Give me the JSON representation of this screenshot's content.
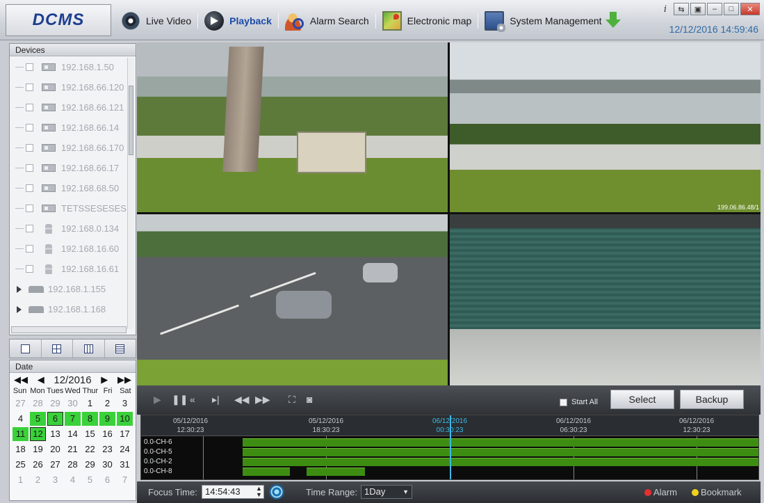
{
  "app": {
    "logo": "DCMS",
    "datetime": "12/12/2016 14:59:46"
  },
  "nav": {
    "items": [
      {
        "label": "Live Video",
        "icon": "camera-eye-icon"
      },
      {
        "label": "Playback",
        "icon": "playback-icon",
        "active": true
      },
      {
        "label": "Alarm Search",
        "icon": "alarm-search-icon"
      },
      {
        "label": "Electronic map",
        "icon": "map-icon"
      },
      {
        "label": "System Management",
        "icon": "system-management-icon"
      }
    ]
  },
  "devices": {
    "title": "Devices",
    "items": [
      {
        "label": "192.168.1.50",
        "type": "camera"
      },
      {
        "label": "192.168.66.120",
        "type": "camera"
      },
      {
        "label": "192.168.66.121",
        "type": "camera"
      },
      {
        "label": "192.168.66.14",
        "type": "camera"
      },
      {
        "label": "192.168.66.170",
        "type": "camera"
      },
      {
        "label": "192.168.66.17",
        "type": "camera"
      },
      {
        "label": "192.168.68.50",
        "type": "camera"
      },
      {
        "label": "TETSSESESES",
        "type": "camera"
      },
      {
        "label": "192.168.0.134",
        "type": "dome"
      },
      {
        "label": "192.168.16.60",
        "type": "dome"
      },
      {
        "label": "192.168.16.61",
        "type": "dome"
      },
      {
        "label": "192.168.1.155",
        "type": "nvr"
      },
      {
        "label": "192.168.1.168",
        "type": "nvr"
      }
    ]
  },
  "date": {
    "title": "Date",
    "month_label": "12/2016",
    "weekdays": [
      "Sun",
      "Mon",
      "Tues",
      "Wed",
      "Thur",
      "Fri",
      "Sat"
    ],
    "days": [
      {
        "d": "27",
        "m": 1
      },
      {
        "d": "28",
        "m": 1
      },
      {
        "d": "29",
        "m": 1
      },
      {
        "d": "30",
        "m": 1
      },
      {
        "d": "1"
      },
      {
        "d": "2"
      },
      {
        "d": "3"
      },
      {
        "d": "4"
      },
      {
        "d": "5",
        "r": 1
      },
      {
        "d": "6",
        "r": 1,
        "s": 1
      },
      {
        "d": "7",
        "r": 1
      },
      {
        "d": "8",
        "r": 1
      },
      {
        "d": "9",
        "r": 1
      },
      {
        "d": "10",
        "r": 1
      },
      {
        "d": "11",
        "r": 1
      },
      {
        "d": "12",
        "r": 1,
        "s": 1
      },
      {
        "d": "13"
      },
      {
        "d": "14"
      },
      {
        "d": "15"
      },
      {
        "d": "16"
      },
      {
        "d": "17"
      },
      {
        "d": "18"
      },
      {
        "d": "19"
      },
      {
        "d": "20"
      },
      {
        "d": "21"
      },
      {
        "d": "22"
      },
      {
        "d": "23"
      },
      {
        "d": "24"
      },
      {
        "d": "25"
      },
      {
        "d": "26"
      },
      {
        "d": "27"
      },
      {
        "d": "28"
      },
      {
        "d": "29"
      },
      {
        "d": "30"
      },
      {
        "d": "31"
      },
      {
        "d": "1",
        "m": 1
      },
      {
        "d": "2",
        "m": 1
      },
      {
        "d": "3",
        "m": 1
      },
      {
        "d": "4",
        "m": 1
      },
      {
        "d": "5",
        "m": 1
      },
      {
        "d": "6",
        "m": 1
      },
      {
        "d": "7",
        "m": 1
      }
    ]
  },
  "video": {
    "osd_text": "199.06.86.48/1"
  },
  "controls": {
    "start_all_label": "Start All",
    "select_label": "Select",
    "backup_label": "Backup"
  },
  "timeline": {
    "labels": [
      {
        "date": "05/12/2016",
        "time": "12:30:23"
      },
      {
        "date": "05/12/2016",
        "time": "18:30:23"
      },
      {
        "date": "06/12/2016",
        "time": "00:30:23",
        "current": true
      },
      {
        "date": "06/12/2016",
        "time": "06:30:23"
      },
      {
        "date": "06/12/2016",
        "time": "12:30:23"
      }
    ],
    "channels": [
      "0.0-CH-6",
      "0.0-CH-5",
      "0.0-CH-2",
      "0.0-CH-8"
    ]
  },
  "footer": {
    "focus_time_label": "Focus Time:",
    "focus_time_value": "14:54:43",
    "time_range_label": "Time Range:",
    "time_range_value": "1Day",
    "alarm_label": "Alarm",
    "bookmark_label": "Bookmark",
    "alarm_color": "#e53030",
    "bookmark_color": "#f1d21c"
  },
  "colors": {
    "recording": "#3d8d12",
    "calendar_record": "#3ad13a",
    "cursor": "#3cb9e6"
  }
}
